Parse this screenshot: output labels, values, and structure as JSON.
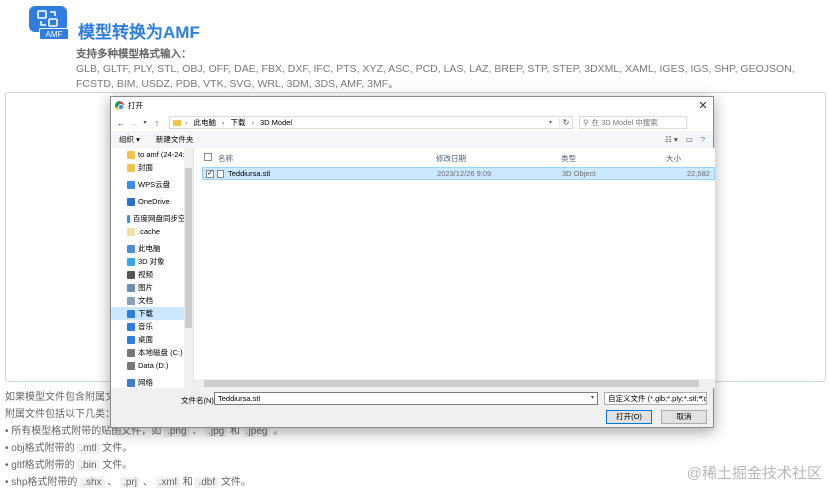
{
  "header": {
    "title": "模型转换为AMF",
    "logo_tag": "AMF"
  },
  "formats": {
    "label": "支持多种模型格式输入：",
    "list": "GLB, GLTF, PLY, STL, OBJ, OFF, DAE, FBX, DXF, IFC, PTS, XYZ, ASC, PCD, LAS, LAZ, BREP, STP, STEP, 3DXML, XAML, IGES, IGS, SHP, GEOJSON, FCSTD, BIM, USDZ, PDB, VTK, SVG, WRL, 3DM, 3DS, AMF, 3MF。"
  },
  "notes": {
    "line1": "如果模型文件包含附属文",
    "line2": "附属文件包括以下几类：",
    "b1_prefix": "• 所有模型格式附带的贴图文件，如",
    "b1_png": ".png",
    "b1_sep": "、",
    "b1_jpg": ".jpg",
    "b1_and": "和",
    "b1_jpeg": ".jpeg",
    "b1_end": "。",
    "b2_prefix": "• obj格式附带的",
    "b2_code": ".mtl",
    "b2_end": "文件。",
    "b3_prefix": "• gltf格式附带的",
    "b3_code": ".bin",
    "b3_end": "文件。",
    "b4_prefix": "• shp格式附带的",
    "b4_shx": ".shx",
    "b4_sep1": "、",
    "b4_prj": ".prj",
    "b4_sep2": "、",
    "b4_xml": ".xml",
    "b4_and": "和",
    "b4_dbf": ".dbf",
    "b4_end": "文件。"
  },
  "watermark": "@稀土掘金技术社区",
  "dialog": {
    "title": "打开",
    "close": "✕",
    "breadcrumbs": [
      "此电脑",
      "下载",
      "3D Model"
    ],
    "search_placeholder": "在 3D Model 中搜索",
    "toolbar": {
      "organize": "组织 ▾",
      "new_folder": "新建文件夹"
    },
    "sidebar": [
      {
        "label": "to amf (24-24:",
        "icon": "folder-icon",
        "color": "#f3c24b"
      },
      {
        "label": "封面",
        "icon": "folder-icon",
        "color": "#f3c24b"
      },
      {
        "label": "WPS云盘",
        "icon": "cloud-icon",
        "color": "#3b8ce8",
        "gap": true
      },
      {
        "label": "OneDrive",
        "icon": "cloud-icon",
        "color": "#2b6fd1",
        "gap": true
      },
      {
        "label": "百度网盘同步空间",
        "icon": "baidu-icon",
        "color": "#3b8ce8",
        "gap": true
      },
      {
        "label": ".cache",
        "icon": "folder-icon",
        "color": "#f3e3a0"
      },
      {
        "label": "此电脑",
        "icon": "computer-icon",
        "color": "#4a90d9",
        "gap": true
      },
      {
        "label": "3D 对象",
        "icon": "3d-objects-icon",
        "color": "#35a6e8"
      },
      {
        "label": "视频",
        "icon": "video-icon",
        "color": "#555555"
      },
      {
        "label": "图片",
        "icon": "pictures-icon",
        "color": "#6b8fb5"
      },
      {
        "label": "文档",
        "icon": "documents-icon",
        "color": "#8aa0b8"
      },
      {
        "label": "下载",
        "icon": "download-icon",
        "color": "#2f7de1",
        "selected": true
      },
      {
        "label": "音乐",
        "icon": "music-icon",
        "color": "#2f7de1"
      },
      {
        "label": "桌面",
        "icon": "desktop-icon",
        "color": "#2f7de1"
      },
      {
        "label": "本地磁盘 (C:)",
        "icon": "drive-icon",
        "color": "#777777"
      },
      {
        "label": "Data (D:)",
        "icon": "drive-icon",
        "color": "#777777"
      },
      {
        "label": "网络",
        "icon": "network-icon",
        "color": "#3b7fd0",
        "gap": true
      }
    ],
    "columns": {
      "name": "名称",
      "date": "修改日期",
      "type": "类型",
      "size": "大小"
    },
    "files": [
      {
        "name": "Teddiursa.stl",
        "date": "2023/12/26 9:09",
        "type": "3D Object",
        "size": "22,582"
      }
    ],
    "filename_label": "文件名(N):",
    "filename_value": "Teddiursa.stl",
    "filetype_value": "自定义文件 (*.glb;*.ply;*.stl;*.c",
    "open_button": "打开(O)",
    "cancel_button": "取消"
  }
}
